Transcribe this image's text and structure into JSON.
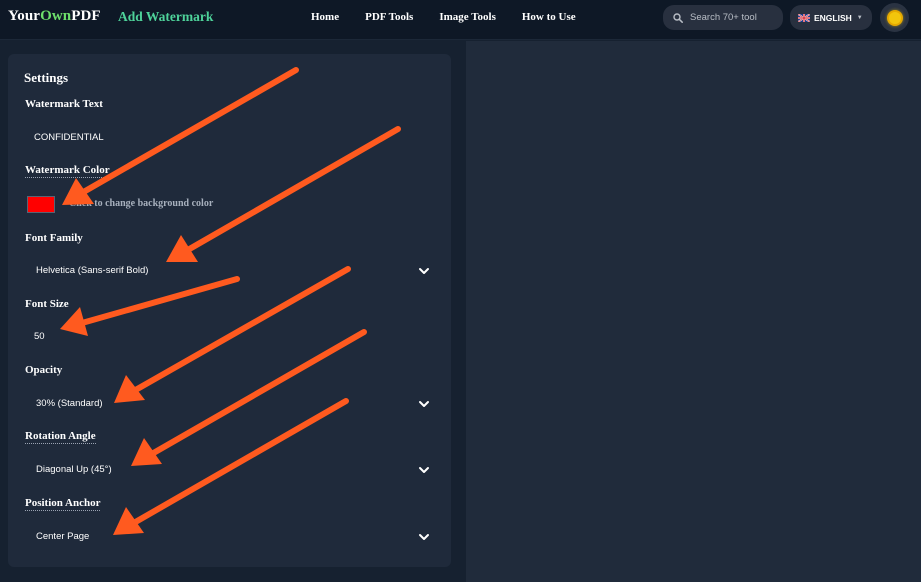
{
  "header": {
    "logo": {
      "part1": "Your",
      "part2": "Own",
      "part3": "PDF"
    },
    "tool_title": "Add Watermark",
    "nav": [
      {
        "label": "Home"
      },
      {
        "label": "PDF Tools"
      },
      {
        "label": "Image Tools"
      },
      {
        "label": "How to Use"
      }
    ],
    "search": {
      "placeholder": "Search 70+ tool",
      "icon": "search-icon"
    },
    "language": {
      "label": "ENGLISH",
      "flag": "uk-flag-icon"
    },
    "theme_toggle": {
      "icon": "sun-icon"
    }
  },
  "settings": {
    "title": "Settings",
    "watermark_text": {
      "label": "Watermark Text",
      "value": "CONFIDENTIAL"
    },
    "watermark_color": {
      "label": "Watermark Color",
      "color": "#ff0000",
      "hint": "Click to change background color"
    },
    "font_family": {
      "label": "Font Family",
      "value": "Helvetica (Sans-serif Bold)"
    },
    "font_size": {
      "label": "Font Size",
      "value": "50"
    },
    "opacity": {
      "label": "Opacity",
      "value": "30% (Standard)"
    },
    "rotation_angle": {
      "label": "Rotation Angle",
      "value": "Diagonal Up (45°)"
    },
    "position_anchor": {
      "label": "Position Anchor",
      "value": "Center Page"
    }
  },
  "colors": {
    "accent_green": "#4ed29a",
    "logo_green": "#6ee06b",
    "annotation_arrow": "#ff5a1f",
    "background": "#162130",
    "card": "#1f2a3b"
  }
}
